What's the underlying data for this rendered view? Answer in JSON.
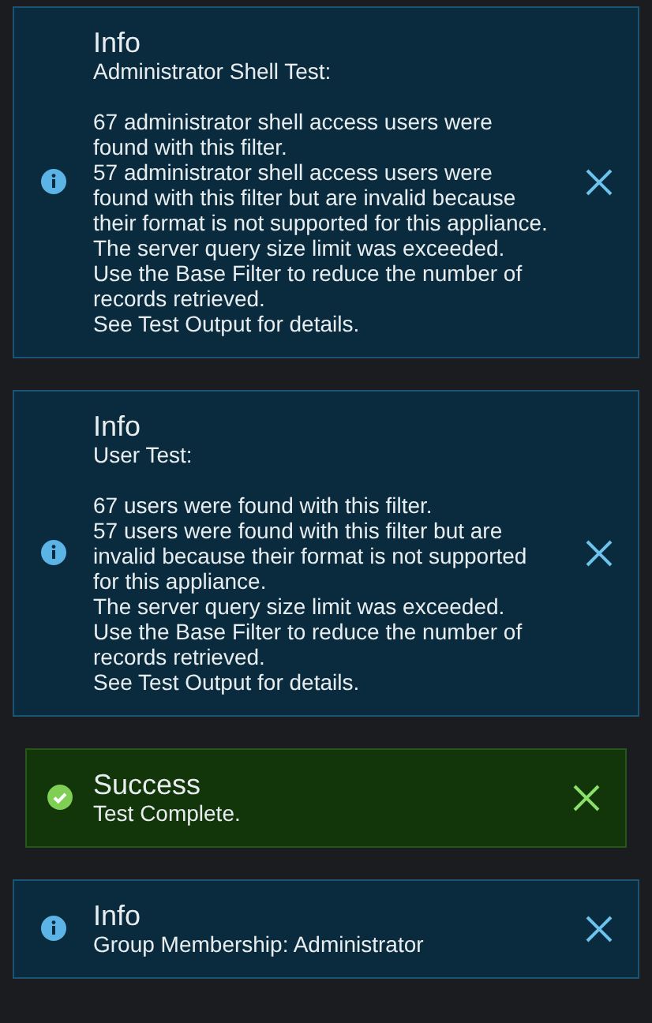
{
  "alerts": [
    {
      "kind": "info",
      "title": "Info",
      "subtitle": "Administrator Shell Test:",
      "lines": [
        "67 administrator shell access users were found with this filter.",
        "57 administrator shell access users were found with this filter but are invalid because their format is not supported for this appliance.",
        "The server query size limit was exceeded.",
        "Use the Base Filter to reduce the number of records retrieved.",
        "See Test Output for details."
      ]
    },
    {
      "kind": "info",
      "title": "Info",
      "subtitle": "User Test:",
      "lines": [
        "67 users were found with this filter.",
        "57 users were found with this filter but are invalid because their format is not supported for this appliance.",
        "The server query size limit was exceeded.",
        "Use the Base Filter to reduce the number of records retrieved.",
        "See Test Output for details."
      ]
    },
    {
      "kind": "success",
      "title": "Success",
      "subtitle": "Test Complete."
    },
    {
      "kind": "info",
      "title": "Info",
      "subtitle": "Group Membership: Administrator"
    }
  ]
}
